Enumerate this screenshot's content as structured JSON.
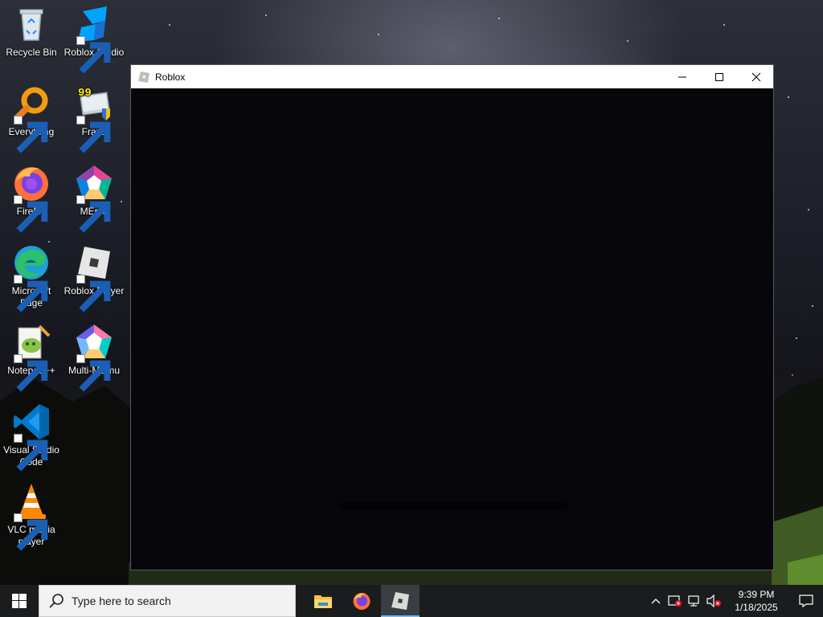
{
  "desktop": {
    "icons": [
      {
        "label": "Recycle Bin",
        "icon": "recycle-bin-icon"
      },
      {
        "label": "Roblox Studio",
        "icon": "roblox-studio-icon"
      },
      {
        "label": "Everything",
        "icon": "everything-search-icon"
      },
      {
        "label": "Fraps",
        "icon": "fraps-icon"
      },
      {
        "label": "Firefox",
        "icon": "firefox-icon"
      },
      {
        "label": "MEmu",
        "icon": "memu-icon"
      },
      {
        "label": "Microsoft Edge",
        "icon": "edge-icon"
      },
      {
        "label": "Roblox Player",
        "icon": "roblox-player-icon"
      },
      {
        "label": "Notepad++",
        "icon": "notepadpp-icon"
      },
      {
        "label": "Multi-MEmu",
        "icon": "multi-memu-icon"
      },
      {
        "label": "Visual Studio Code",
        "icon": "vscode-icon"
      },
      {
        "label": "VLC media player",
        "icon": "vlc-icon"
      }
    ]
  },
  "window": {
    "title": "Roblox",
    "icon": "roblox-icon",
    "controls": {
      "minimize": "minimize-icon",
      "maximize": "maximize-icon",
      "close": "close-icon"
    }
  },
  "taskbar": {
    "search_placeholder": "Type here to search",
    "apps": [
      {
        "name": "File Explorer",
        "icon": "file-explorer-icon"
      },
      {
        "name": "Firefox",
        "icon": "firefox-icon"
      },
      {
        "name": "Roblox",
        "icon": "roblox-icon",
        "active": true
      }
    ],
    "tray": {
      "time": "9:39 PM",
      "date": "1/18/2025",
      "icons": [
        "chevron-up-icon",
        "security-icon",
        "network-icon",
        "volume-muted-icon"
      ]
    }
  },
  "colors": {
    "taskbar_bg": "#1a1c1e",
    "window_bg": "#07070b",
    "active_app_underline": "#76b9ed"
  }
}
